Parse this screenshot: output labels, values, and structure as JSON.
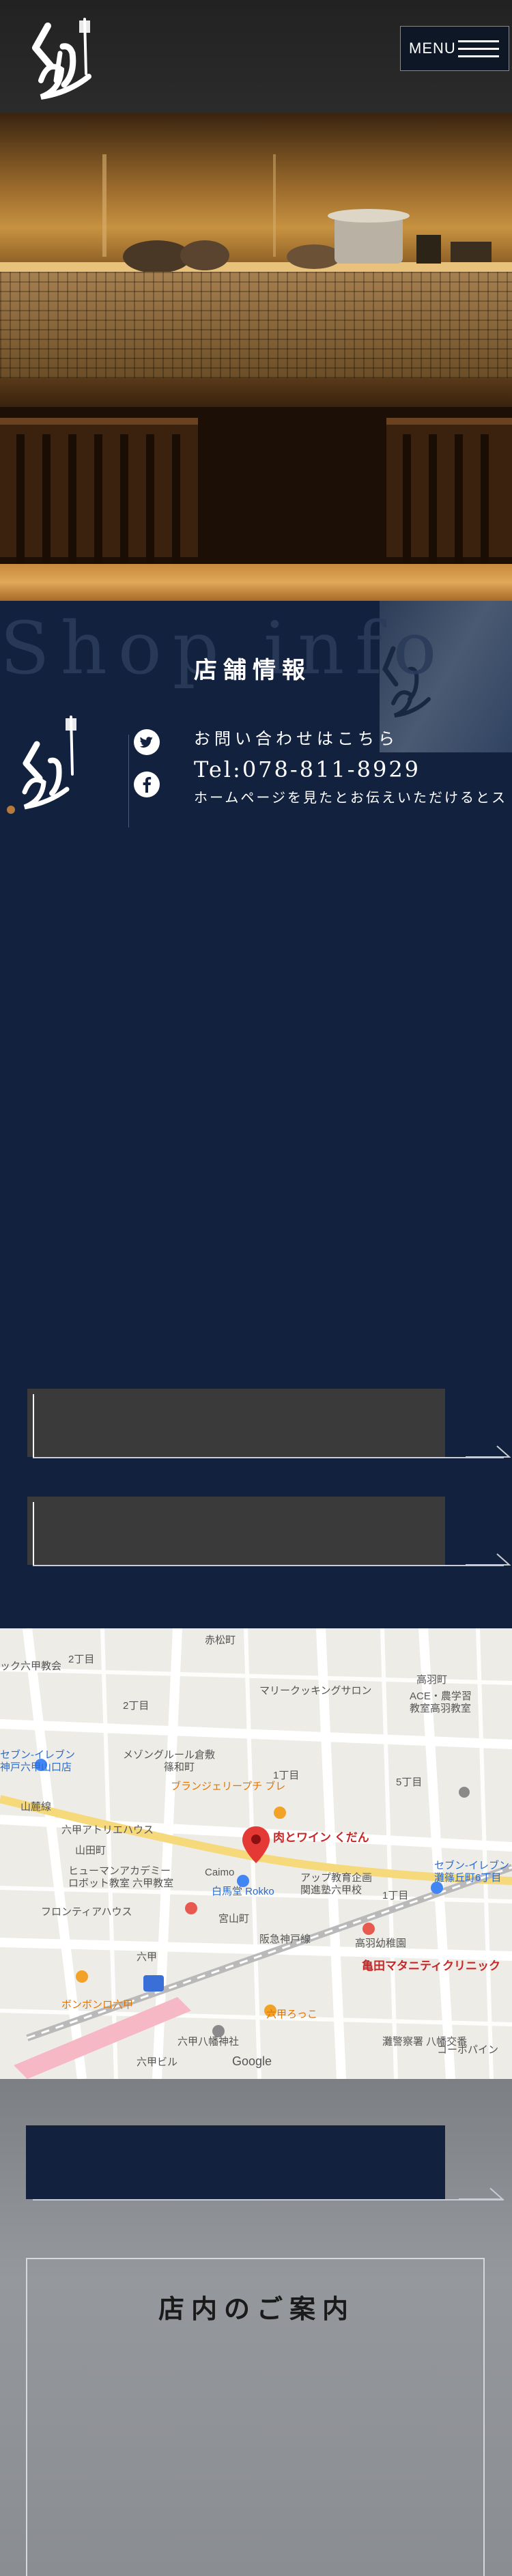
{
  "header": {
    "logo_alt": "肉とワイン くだん",
    "menu_label": "MENU"
  },
  "shop_info": {
    "bg_text": "Shop info",
    "title": "店舗情報",
    "contact_lead": "お問い合わせはこちら",
    "tel": "Tel:078-811-8929",
    "note": "ホームページを見たとお伝えいただけるとス"
  },
  "map": {
    "labels": [
      {
        "text": "赤松町",
        "cls": "g"
      },
      {
        "text": "2丁目",
        "cls": "g"
      },
      {
        "text": "ック六甲教会",
        "cls": "g"
      },
      {
        "text": "高羽町",
        "cls": "g"
      },
      {
        "text": "マリークッキングサロン",
        "cls": "g"
      },
      {
        "text": "ACE・農学習",
        "cls": "g"
      },
      {
        "text": "教室高羽教室",
        "cls": "g"
      },
      {
        "text": "2丁目",
        "cls": "g"
      },
      {
        "text": "セブン-イレブン",
        "cls": "b"
      },
      {
        "text": "神戸六甲山口店",
        "cls": "b"
      },
      {
        "text": "メゾングルール倉敷",
        "cls": "g"
      },
      {
        "text": "篠和町",
        "cls": "g"
      },
      {
        "text": "1丁目",
        "cls": "g"
      },
      {
        "text": "5丁目",
        "cls": "g"
      },
      {
        "text": "ブランジェリープチ ブレ",
        "cls": "o"
      },
      {
        "text": "山麓線",
        "cls": "g"
      },
      {
        "text": "六甲アトリエハウス",
        "cls": "g"
      },
      {
        "text": "山田町",
        "cls": "g"
      },
      {
        "text": "肉とワイン くだん",
        "cls": "r"
      },
      {
        "text": "ヒューマンアカデミー",
        "cls": "g"
      },
      {
        "text": "ロボット教室 六甲教室",
        "cls": "g"
      },
      {
        "text": "Caimo",
        "cls": "g"
      },
      {
        "text": "白馬堂 Rokko",
        "cls": "b"
      },
      {
        "text": "アップ教育企画",
        "cls": "g"
      },
      {
        "text": "関進塾六甲校",
        "cls": "g"
      },
      {
        "text": "1丁目",
        "cls": "g"
      },
      {
        "text": "セブン-イレブン",
        "cls": "b"
      },
      {
        "text": "灘篠丘町6丁目",
        "cls": "b"
      },
      {
        "text": "フロンティアハウス",
        "cls": "g"
      },
      {
        "text": "宮山町",
        "cls": "g"
      },
      {
        "text": "阪急神戸線",
        "cls": "g"
      },
      {
        "text": "高羽幼稚園",
        "cls": "g"
      },
      {
        "text": "亀田マタニティクリニック",
        "cls": "r"
      },
      {
        "text": "六甲",
        "cls": "g"
      },
      {
        "text": "ボンボンロ六甲",
        "cls": "o"
      },
      {
        "text": "六甲ろっこ",
        "cls": "o"
      },
      {
        "text": "六甲八幡神社",
        "cls": "g"
      },
      {
        "text": "六甲ビル",
        "cls": "g"
      },
      {
        "text": "灘警察署 八幡交番",
        "cls": "g"
      },
      {
        "text": "コーポパイン",
        "cls": "g"
      },
      {
        "text": "Google",
        "cls": "google"
      }
    ]
  },
  "guide": {
    "title": "店内のご案内"
  },
  "colors": {
    "navy": "#12223e",
    "header_bg": "#2a2a2a",
    "dark_button": "#3a3a3a",
    "gray_section": "#8a8d92",
    "pin_red": "#e53935"
  }
}
